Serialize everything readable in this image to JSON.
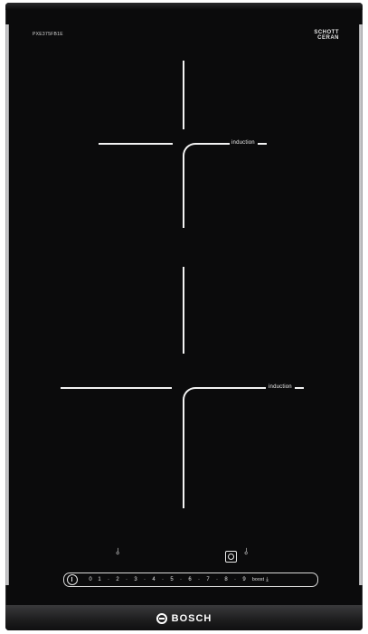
{
  "model_label": "PXE375FB1E",
  "schott": {
    "line1": "SCHOTT",
    "line2": "CERAN",
    "sub": ""
  },
  "zones": [
    {
      "label": "induction"
    },
    {
      "label": "induction"
    }
  ],
  "controls": {
    "timer_icon": "timer-icon",
    "zone_select_icon": "zone-select-icon",
    "power_icon": "power-icon",
    "slider_values": [
      "0",
      "1",
      "2",
      "3",
      "4",
      "5",
      "6",
      "7",
      "8",
      "9"
    ],
    "boost_label": "boost",
    "boost_icon": "boost-icon"
  },
  "brand": {
    "name": "BOSCH"
  },
  "colors": {
    "glass": "#0b0b0c",
    "markings": "#f3f3f3"
  }
}
